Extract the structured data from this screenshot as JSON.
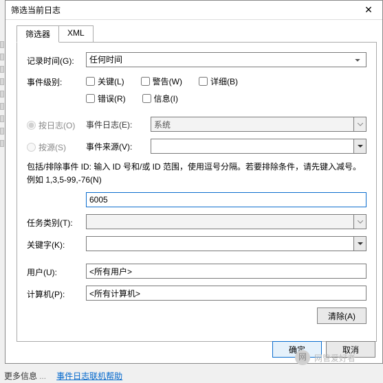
{
  "window": {
    "title": "筛选当前日志"
  },
  "tabs": {
    "filter": "筛选器",
    "xml": "XML"
  },
  "form": {
    "log_time": {
      "label": "记录时间(G):",
      "value": "任何时间"
    },
    "level": {
      "label": "事件级别:",
      "critical": "关键(L)",
      "warning": "警告(W)",
      "verbose": "详细(B)",
      "error": "错误(R)",
      "info": "信息(I)"
    },
    "by_log": {
      "label": "按日志(O)",
      "event_log_label": "事件日志(E):",
      "event_log_value": "系统"
    },
    "by_source": {
      "label": "按源(S)",
      "event_source_label": "事件来源(V):",
      "event_source_value": ""
    },
    "id_hint": "包括/排除事件 ID: 输入 ID 号和/或 ID 范围，使用逗号分隔。若要排除条件，请先键入减号。例如 1,3,5-99,-76(N)",
    "id_value": "6005",
    "task_cat": {
      "label": "任务类别(T):"
    },
    "keywords": {
      "label": "关键字(K):"
    },
    "user": {
      "label": "用户(U):",
      "value": "<所有用户>"
    },
    "computer": {
      "label": "计算机(P):",
      "value": "<所有计算机>"
    },
    "clear": "清除(A)"
  },
  "buttons": {
    "ok": "确定",
    "cancel": "取消"
  },
  "watermark": "网管爱好者",
  "footer": {
    "more": "更多信息",
    "link": "事件日志联机帮助"
  }
}
